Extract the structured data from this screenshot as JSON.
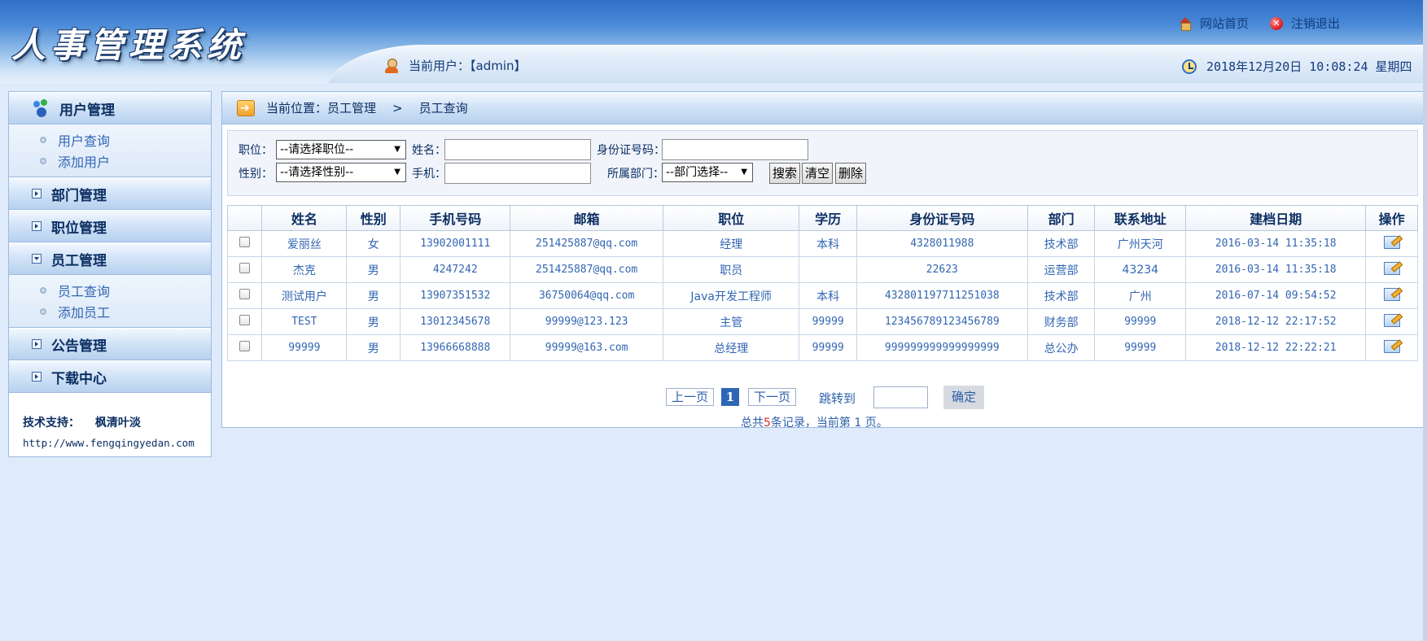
{
  "header": {
    "logo": "人事管理系统",
    "links": [
      {
        "icon": "home-icon",
        "label": "网站首页"
      },
      {
        "icon": "close-icon",
        "label": "注销退出"
      }
    ],
    "current_user_label": "当前用户：【admin】",
    "datetime": "2018年12月20日 10:08:24 星期四"
  },
  "sidebar": {
    "sections": [
      {
        "label": "用户管理",
        "expanded": true,
        "items": [
          "用户查询",
          "添加用户"
        ]
      },
      {
        "label": "部门管理",
        "expanded": false,
        "items": []
      },
      {
        "label": "职位管理",
        "expanded": false,
        "items": []
      },
      {
        "label": "员工管理",
        "expanded": true,
        "items": [
          "员工查询",
          "添加员工"
        ]
      },
      {
        "label": "公告管理",
        "expanded": false,
        "items": []
      },
      {
        "label": "下载中心",
        "expanded": false,
        "items": []
      }
    ],
    "support": {
      "label": "技术支持：",
      "name": "枫清叶淡",
      "url": "http://www.fengqingyedan.com"
    }
  },
  "breadcrumb": {
    "prefix": "当前位置：员工管理",
    "separator": ">",
    "current": "员工查询"
  },
  "search": {
    "job_label": "职位：",
    "job_value": "--请选择职位--",
    "name_label": "姓名：",
    "name_value": "",
    "idcard_label": "身份证号码：",
    "idcard_value": "",
    "sex_label": "性别：",
    "sex_value": "--请选择性别--",
    "phone_label": "手机：",
    "phone_value": "",
    "dept_label": "所属部门：",
    "dept_value": "--部门选择--",
    "search_btn": "搜索",
    "clear_btn": "清空",
    "delete_btn": "删除"
  },
  "table": {
    "headers": [
      "姓名",
      "性别",
      "手机号码",
      "邮箱",
      "职位",
      "学历",
      "身份证号码",
      "部门",
      "联系地址",
      "建档日期",
      "操作"
    ],
    "rows": [
      {
        "name": "爱丽丝",
        "sex": "女",
        "phone": "13902001111",
        "email": "251425887@qq.com",
        "job": "经理",
        "edu": "本科",
        "idcard": "4328011988",
        "dept": "技术部",
        "addr": "广州天河",
        "date": "2016-03-14 11:35:18"
      },
      {
        "name": "杰克",
        "sex": "男",
        "phone": "4247242",
        "email": "251425887@qq.com",
        "job": "职员",
        "edu": "",
        "idcard": "22623",
        "dept": "运营部",
        "addr": "43234",
        "date": "2016-03-14 11:35:18"
      },
      {
        "name": "测试用户",
        "sex": "男",
        "phone": "13907351532",
        "email": "36750064@qq.com",
        "job": "Java开发工程师",
        "edu": "本科",
        "idcard": "432801197711251038",
        "dept": "技术部",
        "addr": "广州",
        "date": "2016-07-14 09:54:52"
      },
      {
        "name": "TEST",
        "sex": "男",
        "phone": "13012345678",
        "email": "99999@123.123",
        "job": "主管",
        "edu": "99999",
        "idcard": "123456789123456789",
        "dept": "财务部",
        "addr": "99999",
        "date": "2018-12-12 22:17:52"
      },
      {
        "name": "99999",
        "sex": "男",
        "phone": "13966668888",
        "email": "99999@163.com",
        "job": "总经理",
        "edu": "99999",
        "idcard": "999999999999999999",
        "dept": "总公办",
        "addr": "99999",
        "date": "2018-12-12 22:22:21"
      }
    ]
  },
  "pager": {
    "prev": "上一页",
    "current_page": "1",
    "next": "下一页",
    "jump_label": "跳转到",
    "jump_value": "",
    "go": "确定",
    "summary_pre": "总共",
    "total": "5",
    "summary_mid": "条记录，当前第",
    "summary_page": " 1 ",
    "summary_post": "页。"
  },
  "colors": {
    "accent": "#2e66b6",
    "link": "#3266b3",
    "background": "#dfeafa",
    "highlight": "#e0262a"
  }
}
